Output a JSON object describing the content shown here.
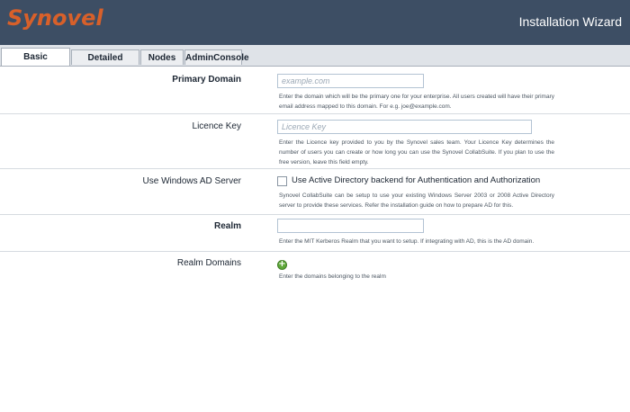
{
  "header": {
    "logo_text": "Synovel",
    "title": "Installation Wizard"
  },
  "tabs": [
    {
      "label": "Basic Information",
      "active": true
    },
    {
      "label": "Detailed Settings",
      "active": false
    },
    {
      "label": "Nodes",
      "active": false
    },
    {
      "label": "AdminConsole",
      "active": false
    }
  ],
  "form": {
    "primary_domain": {
      "label": "Primary Domain",
      "placeholder": "example.com",
      "value": "",
      "help": "Enter the domain which will be the primary one for your enterprise. All users created will have their primary email address mapped to this domain. For e.g. joe@example.com."
    },
    "licence_key": {
      "label": "Licence Key",
      "placeholder": "Licence Key",
      "value": "",
      "help": "Enter the Licence key provided to you by the Synovel sales team. Your Licence Key determines the number of users you can create or how long you can use the Synovel CollabSuite. If you plan to use the free version, leave this field empty."
    },
    "windows_ad": {
      "label": "Use Windows AD Server",
      "checkbox_label": "Use Active Directory backend for Authentication and Authorization",
      "checked": false,
      "help": "Synovel CollabSuite can be setup to use your existing Windows Server 2003 or 2008 Active Directory server to provide these services. Refer the installation guide on how to prepare AD for this."
    },
    "realm": {
      "label": "Realm",
      "placeholder": "",
      "value": "",
      "help": "Enter the MIT Kerberos Realm that you want to setup. If integrating with AD, this is the AD domain."
    },
    "realm_domains": {
      "label": "Realm Domains",
      "add_icon_glyph": "+",
      "help": "Enter the domains belonging to the realm"
    }
  },
  "colors": {
    "header_bg": "#3d4e64",
    "logo": "#d8602a",
    "add_icon": "#5fa83a"
  }
}
